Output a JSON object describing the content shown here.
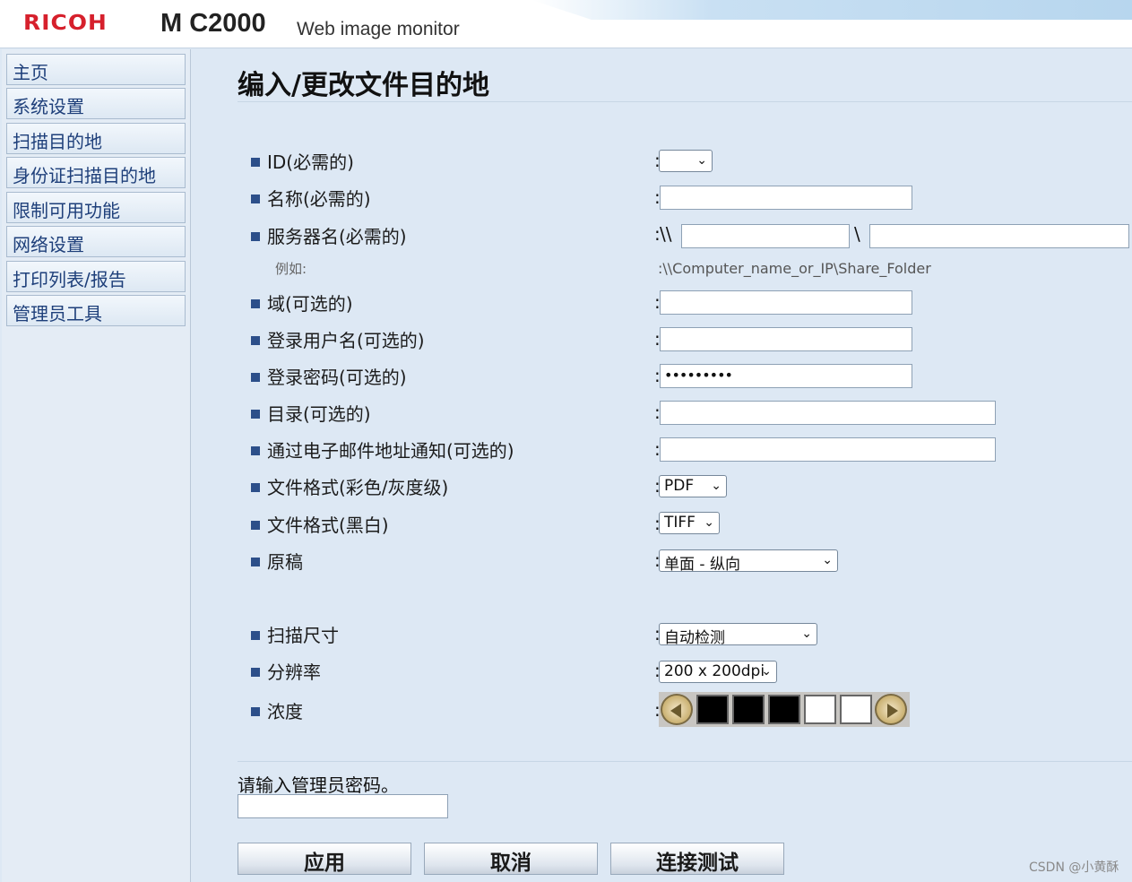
{
  "header": {
    "brand": "RICOH",
    "model": "M C2000",
    "subtitle": "Web image monitor"
  },
  "sidebar": {
    "items": [
      {
        "label": "主页"
      },
      {
        "label": "系统设置"
      },
      {
        "label": "扫描目的地"
      },
      {
        "label": "身份证扫描目的地"
      },
      {
        "label": "限制可用功能"
      },
      {
        "label": "网络设置"
      },
      {
        "label": "打印列表/报告"
      },
      {
        "label": "管理员工具"
      }
    ]
  },
  "page": {
    "title": "编入/更改文件目的地"
  },
  "form": {
    "id_label": "ID(必需的)",
    "id_value": "",
    "name_label": "名称(必需的)",
    "name_value": "",
    "server_label": "服务器名(必需的)",
    "server_prefix": "\\\\",
    "server_sep": "\\",
    "server_value": "",
    "share_value": "",
    "example_label": "例如:",
    "example_text": ":\\\\Computer_name_or_IP\\Share_Folder",
    "domain_label": "域(可选的)",
    "login_user_label": "登录用户名(可选的)",
    "login_password_label": "登录密码(可选的)",
    "login_password_value": "•••••••••",
    "directory_label": "目录(可选的)",
    "email_notify_label": "通过电子邮件地址通知(可选的)",
    "file_format_color_label": "文件格式(彩色/灰度级)",
    "file_format_color_value": "PDF",
    "file_format_bw_label": "文件格式(黑白)",
    "file_format_bw_value": "TIFF",
    "original_label": "原稿",
    "original_value": "单面 - 纵向",
    "scan_size_label": "扫描尺寸",
    "scan_size_value": "自动检测",
    "resolution_label": "分辨率",
    "resolution_value": "200 x 200dpi",
    "density_label": "浓度",
    "density_level": 3,
    "density_max": 5,
    "colon": ":"
  },
  "admin": {
    "prompt": "请输入管理员密码。"
  },
  "buttons": {
    "apply": "应用",
    "cancel": "取消",
    "connection_test": "连接测试"
  },
  "watermark": "CSDN @小黄酥",
  "colors": {
    "brand": "#d6202c",
    "background": "#dde8f4",
    "nav_text": "#1e3f7a"
  }
}
